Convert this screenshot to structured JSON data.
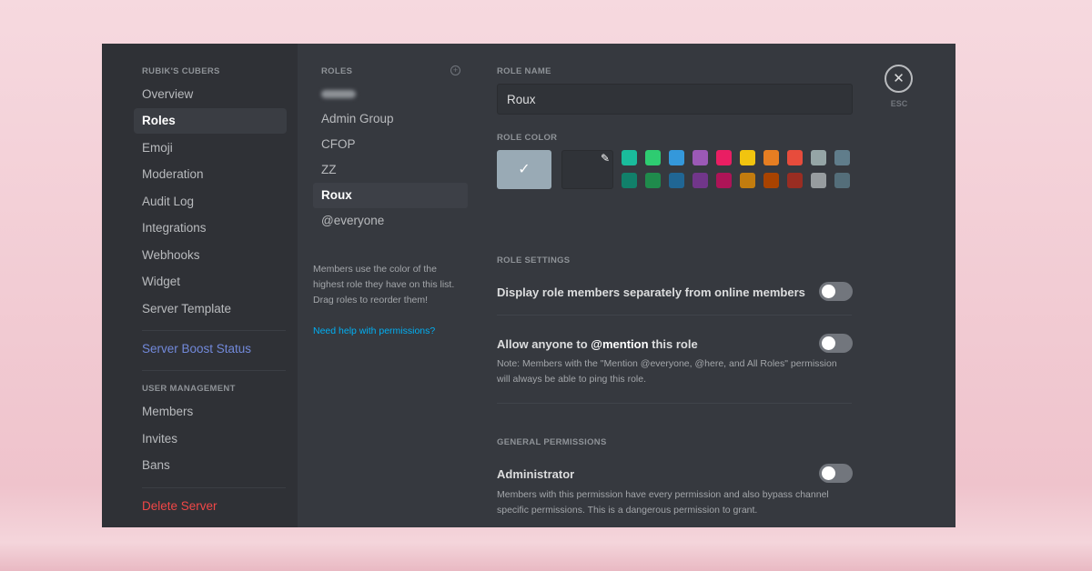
{
  "sidebar": {
    "server_name": "RUBIK'S CUBERS",
    "items": [
      "Overview",
      "Roles",
      "Emoji",
      "Moderation",
      "Audit Log",
      "Integrations",
      "Webhooks",
      "Widget",
      "Server Template"
    ],
    "boost": "Server Boost Status",
    "user_mgmt_header": "USER MANAGEMENT",
    "user_items": [
      "Members",
      "Invites",
      "Bans"
    ],
    "delete": "Delete Server",
    "selected": "Roles"
  },
  "roles": {
    "header": "ROLES",
    "list": [
      "Admin Group",
      "CFOP",
      "ZZ",
      "Roux",
      "@everyone"
    ],
    "selected": "Roux",
    "help_text": "Members use the color of the highest role they have on this list. Drag roles to reorder them!",
    "help_link": "Need help with permissions?"
  },
  "main": {
    "role_name_label": "ROLE NAME",
    "role_name_value": "Roux",
    "role_color_label": "ROLE COLOR",
    "default_color": "#99aab5",
    "colors_top": [
      "#1abc9c",
      "#2ecc71",
      "#3498db",
      "#9b59b6",
      "#e91e63",
      "#f1c40f",
      "#e67e22",
      "#e74c3c",
      "#95a5a6",
      "#607d8b"
    ],
    "colors_bottom": [
      "#11806a",
      "#1f8b4c",
      "#206694",
      "#71368a",
      "#ad1457",
      "#c27c0e",
      "#a84300",
      "#992d22",
      "#979c9f",
      "#546e7a"
    ],
    "role_settings_label": "ROLE SETTINGS",
    "setting1": "Display role members separately from online members",
    "setting2_pre": "Allow anyone to ",
    "setting2_mention": "@mention",
    "setting2_post": " this role",
    "setting2_note": "Note: Members with the \"Mention @everyone, @here, and All Roles\" permission will always be able to ping this role.",
    "general_label": "GENERAL PERMISSIONS",
    "admin": "Administrator",
    "admin_note": "Members with this permission have every permission and also bypass channel specific permissions. This is a dangerous permission to grant.",
    "toggles": {
      "display_separately": false,
      "mentionable": false,
      "administrator": false
    }
  },
  "close": {
    "label": "ESC"
  }
}
